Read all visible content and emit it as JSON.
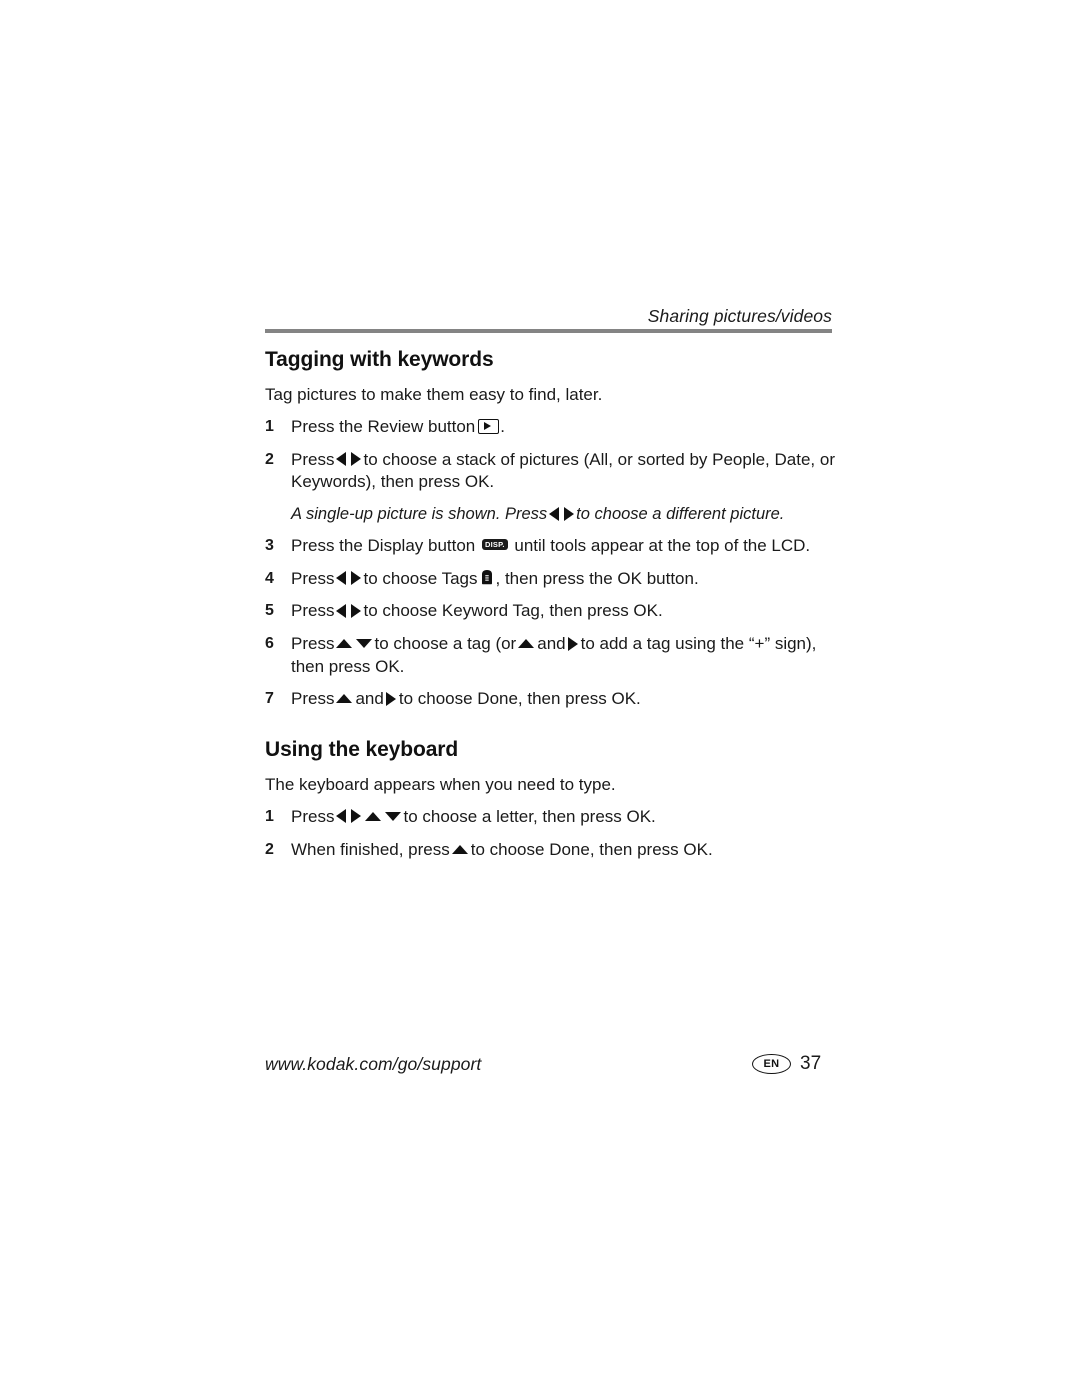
{
  "header": {
    "running_head": "Sharing pictures/videos"
  },
  "sections": [
    {
      "title": "Tagging with keywords",
      "lead": "Tag pictures to make them easy to find, later.",
      "steps": [
        {
          "num": "1",
          "pre": "Press the Review button",
          "icons": [
            "review-button-icon"
          ],
          "post": "."
        },
        {
          "num": "2",
          "pre": "Press",
          "icons": [
            "left-right-arrows-icon"
          ],
          "post": "to choose a stack of pictures (All, or sorted by People, Date, or Keywords), then press OK.",
          "note_pre": "A single-up picture is shown. Press",
          "note_post": "to choose a different picture."
        },
        {
          "num": "3",
          "pre": "Press the Display button",
          "icons": [
            "disp-button-icon"
          ],
          "post": "until tools appear at the top of the LCD."
        },
        {
          "num": "4",
          "pre": "Press",
          "icons": [
            "left-right-arrows-icon",
            "tags-icon"
          ],
          "mid": "to choose Tags",
          "post": ", then press the OK button."
        },
        {
          "num": "5",
          "pre": "Press",
          "icons": [
            "left-right-arrows-icon"
          ],
          "post": "to choose Keyword Tag, then press OK."
        },
        {
          "num": "6",
          "pre": "Press",
          "icons": [
            "up-down-arrows-icon",
            "up-arrow-icon",
            "right-arrow-icon"
          ],
          "mid": "to choose a tag (or",
          "mid2": "and",
          "post": "to add a tag using the “+” sign), then press OK."
        },
        {
          "num": "7",
          "pre": "Press",
          "icons": [
            "up-arrow-icon",
            "right-arrow-icon"
          ],
          "mid": "and",
          "post": "to choose Done, then press OK."
        }
      ]
    },
    {
      "title": "Using the keyboard",
      "lead": "The keyboard appears when you need to type.",
      "steps": [
        {
          "num": "1",
          "pre": "Press",
          "icons": [
            "left-right-arrows-icon",
            "up-down-arrows-icon"
          ],
          "post": "to choose a letter, then press OK."
        },
        {
          "num": "2",
          "pre": "When finished, press",
          "icons": [
            "up-arrow-icon"
          ],
          "post": "to choose Done, then press OK."
        }
      ]
    }
  ],
  "icons": {
    "disp_label": "DISP."
  },
  "footer": {
    "url": "www.kodak.com/go/support",
    "language": "EN",
    "page_number": "37"
  },
  "colors": {
    "rule": "#848484",
    "text": "#1a1a1a",
    "icon": "#111111"
  }
}
